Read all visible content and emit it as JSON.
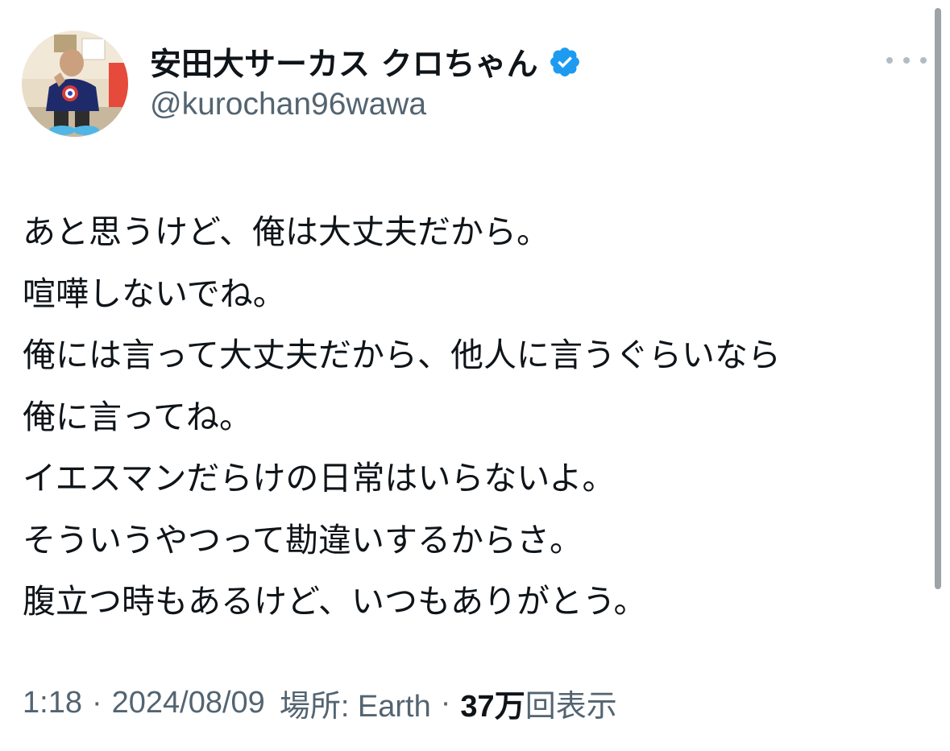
{
  "author": {
    "display_name": "安田大サーカス クロちゃん",
    "handle": "@kurochan96wawa",
    "verified": true,
    "avatar_icon": "profile-photo"
  },
  "tweet": {
    "lines": [
      "あと思うけど、俺は大丈夫だから。",
      "喧嘩しないでね。",
      "俺には言って大丈夫だから、他人に言うぐらいなら",
      "俺に言ってね。",
      "イエスマンだらけの日常はいらないよ。",
      "そういうやつって勘違いするからさ。",
      "腹立つ時もあるけど、いつもありがとう。"
    ]
  },
  "meta": {
    "time": "1:18",
    "separator": "·",
    "date": "2024/08/09",
    "location_label": "場所: Earth",
    "views_count": "37万",
    "views_label": "回表示"
  },
  "icons": {
    "more": "more-horizontal-icon",
    "verified": "verified-badge-icon"
  },
  "colors": {
    "text_primary": "#0f1419",
    "text_secondary": "#536471",
    "verified_blue": "#1d9bf0"
  }
}
